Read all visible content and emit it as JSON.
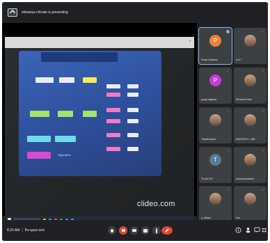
{
  "topbar": {
    "presenting_text": "vidvanya chivate is presenting"
  },
  "shared_screen": {
    "watermark": "clideo.com",
    "board_caption": "Tarja Adi ▾"
  },
  "participants": [
    {
      "name": "Pooja Gawand",
      "initial": "P",
      "color": "#f0813a",
      "mic": "on"
    },
    {
      "name": "smi ?",
      "initial": "",
      "color": "",
      "mic": "off"
    },
    {
      "name": "pooja salgude",
      "initial": "P",
      "color": "#c43dd9",
      "mic": "off"
    },
    {
      "name": "Shrilaxmi Sam",
      "initial": "",
      "color": "",
      "mic": "off"
    },
    {
      "name": "Tripathi Aduri",
      "initial": "",
      "color": "",
      "mic": "off"
    },
    {
      "name": "MAHESH K. JAD",
      "initial": "",
      "color": "",
      "mic": "off"
    },
    {
      "name": "TILAK ICP",
      "initial": "T",
      "color": "#5a7a8f",
      "mic": "off"
    },
    {
      "name": "sushanti kamble",
      "initial": "",
      "color": "",
      "mic": "off"
    },
    {
      "name": "s_idhara",
      "initial": "",
      "color": "",
      "mic": "off"
    },
    {
      "name": "You",
      "initial": "",
      "color": "",
      "mic": "off"
    }
  ],
  "bottombar": {
    "time": "8:20 AM",
    "separator": "|",
    "meeting_code": "fhr-qaox-srm"
  },
  "icons": {
    "present": "presenting-screen-icon",
    "mic": "microphone-icon",
    "camera": "camera-off-icon",
    "captions": "captions-icon",
    "present_now": "present-now-icon",
    "more": "more-options-icon",
    "hangup": "hang-up-icon",
    "info": "info-icon",
    "people": "people-icon",
    "chat": "chat-icon",
    "activities": "activities-icon"
  },
  "colors": {
    "background": "#202124",
    "tile": "#3c4043",
    "hangup": "#ea4335",
    "accent": "#8ab4f8"
  }
}
